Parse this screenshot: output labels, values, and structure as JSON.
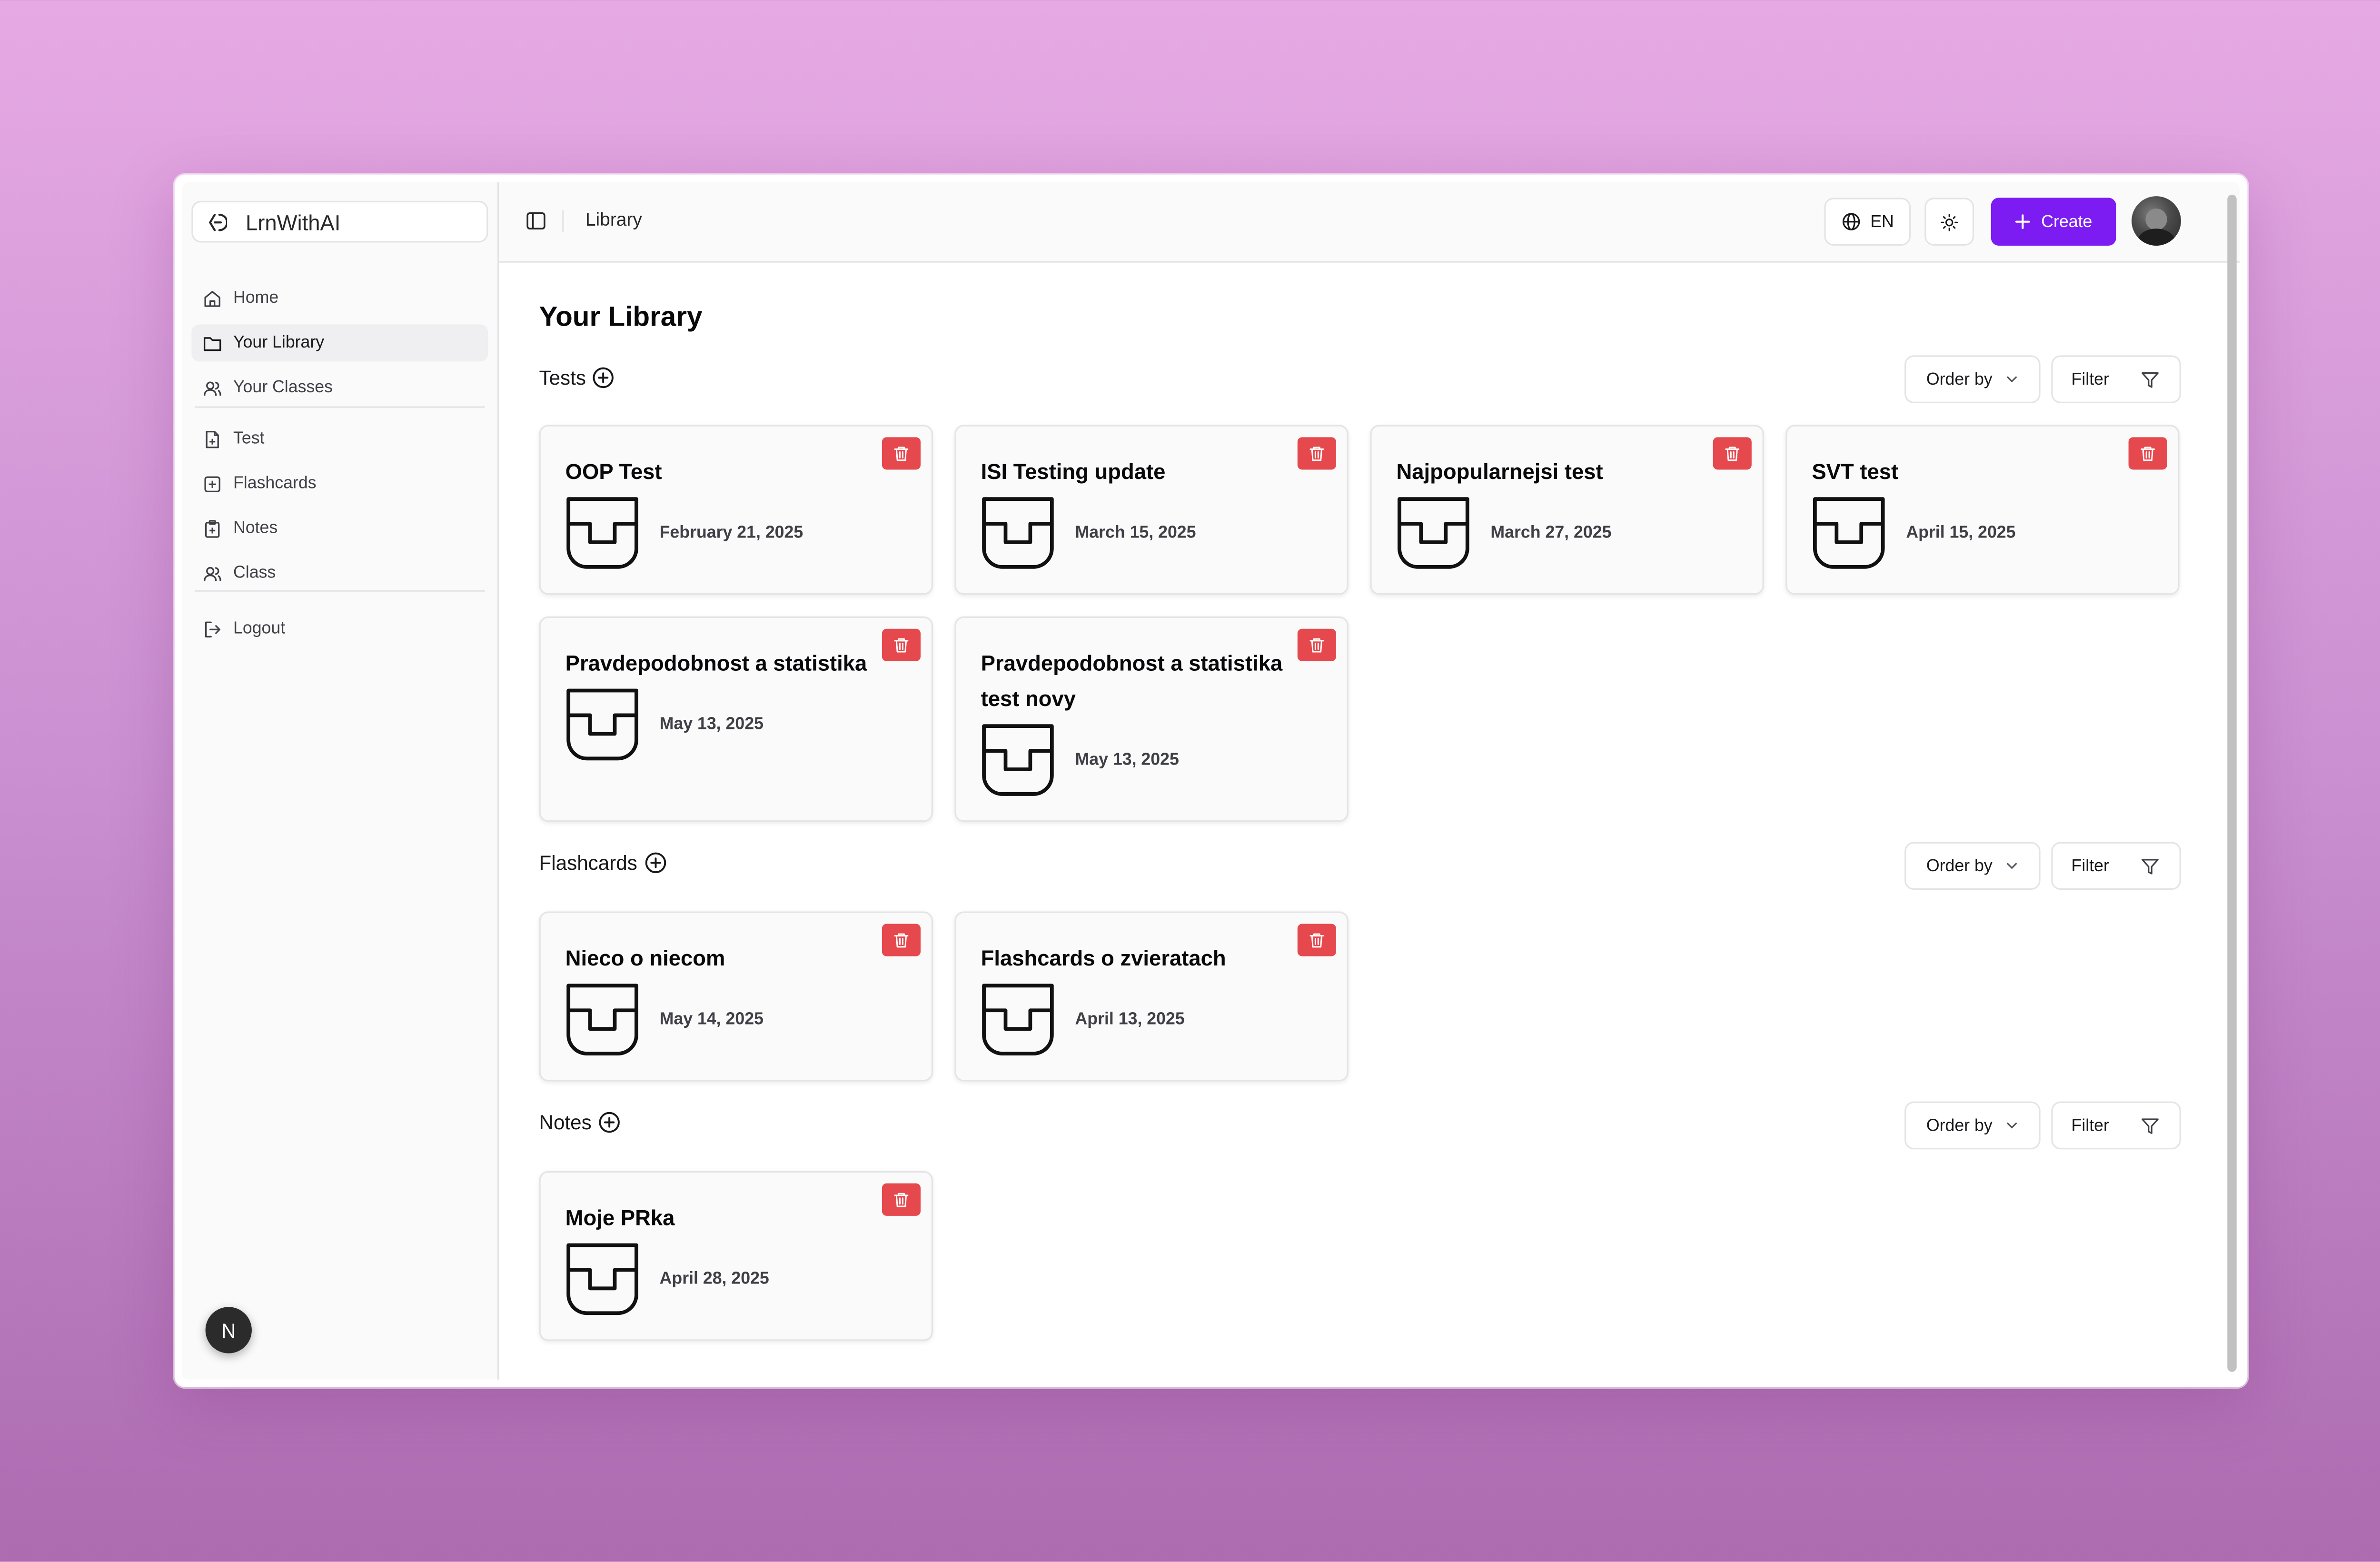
{
  "brand": {
    "name": "LrnWithAI"
  },
  "sidebar": {
    "items": [
      {
        "label": "Home",
        "icon": "home-icon"
      },
      {
        "label": "Your Library",
        "icon": "folder-icon",
        "active": true
      },
      {
        "label": "Your Classes",
        "icon": "users-icon"
      },
      {
        "label": "Test",
        "icon": "file-plus-icon"
      },
      {
        "label": "Flashcards",
        "icon": "square-plus-icon"
      },
      {
        "label": "Notes",
        "icon": "clipboard-plus-icon"
      },
      {
        "label": "Class",
        "icon": "users-icon"
      },
      {
        "label": "Logout",
        "icon": "logout-icon"
      }
    ],
    "badge": "N"
  },
  "topbar": {
    "breadcrumb": "Library",
    "language": "EN",
    "create_label": "Create"
  },
  "page": {
    "title": "Your Library"
  },
  "controls": {
    "order_by": "Order by",
    "filter": "Filter"
  },
  "sections": {
    "tests": {
      "label": "Tests",
      "cards": [
        {
          "title": "OOP Test",
          "date": "February 21, 2025"
        },
        {
          "title": "ISI Testing update",
          "date": "March 15, 2025"
        },
        {
          "title": "Najpopularnejsi test",
          "date": "March 27, 2025"
        },
        {
          "title": "SVT test",
          "date": "April 15, 2025"
        },
        {
          "title": "Pravdepodobnost a statistika",
          "date": "May 13, 2025"
        },
        {
          "title": "Pravdepodobnost a statistika test novy",
          "date": "May 13, 2025"
        }
      ]
    },
    "flashcards": {
      "label": "Flashcards",
      "cards": [
        {
          "title": "Nieco o niecom",
          "date": "May 14, 2025"
        },
        {
          "title": "Flashcards o zvieratach",
          "date": "April 13, 2025"
        }
      ]
    },
    "notes": {
      "label": "Notes",
      "cards": [
        {
          "title": "Moje PRka",
          "date": "April 28, 2025"
        }
      ]
    }
  },
  "colors": {
    "accent": "#7c1cf2",
    "delete": "#e5484d",
    "background_top": "#e6a9e4",
    "background_bottom": "#ad6bb0"
  }
}
